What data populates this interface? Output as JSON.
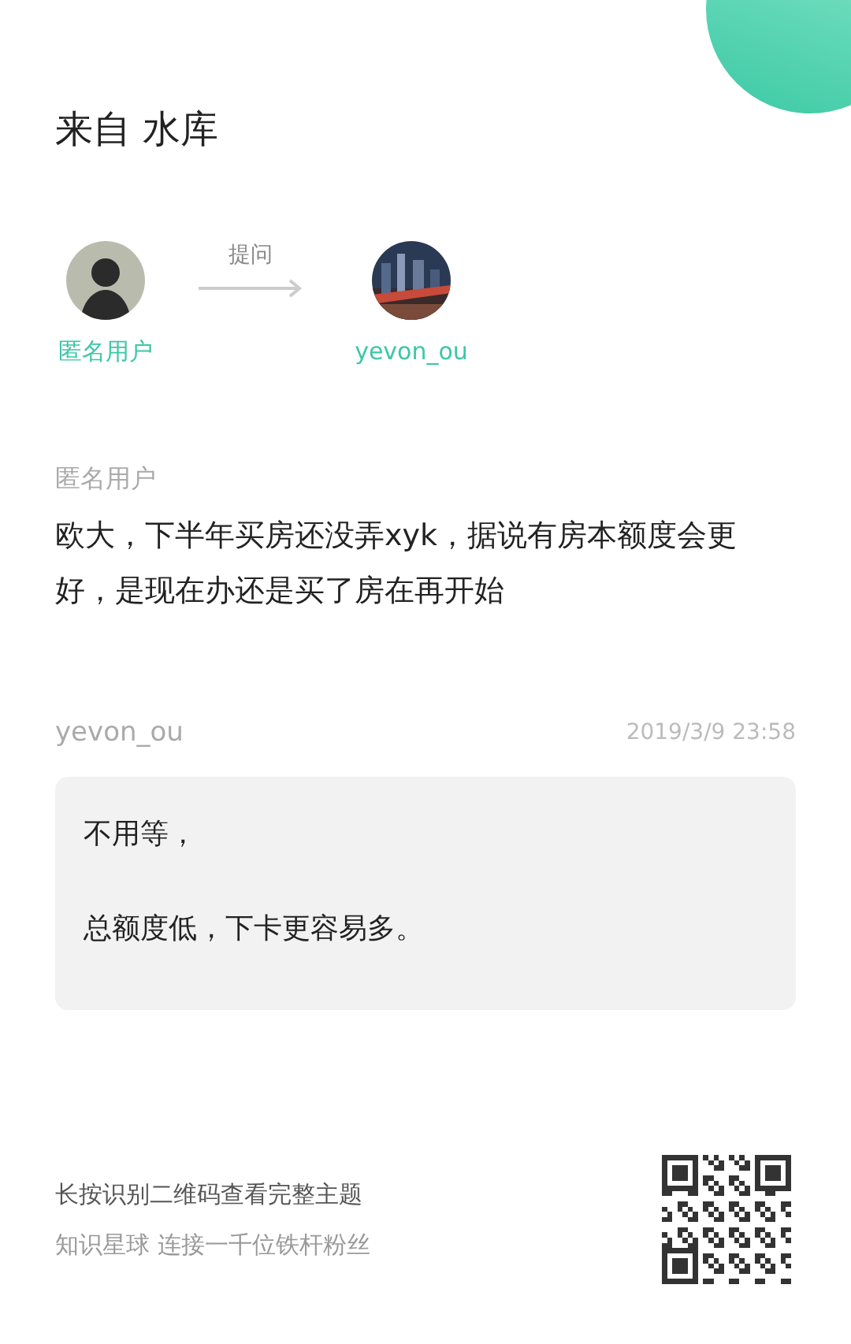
{
  "title": "来自 水库",
  "flow": {
    "asker": {
      "name": "匿名用户"
    },
    "action": "提问",
    "answerer": {
      "name": "yevon_ou"
    }
  },
  "question": {
    "author": "匿名用户",
    "text": "欧大，下半年买房还没弄xyk，据说有房本额度会更好，是现在办还是买了房在再开始"
  },
  "answer": {
    "author": "yevon_ou",
    "time": "2019/3/9 23:58",
    "paragraphs": [
      "不用等，",
      "总额度低，下卡更容易多。"
    ]
  },
  "footer": {
    "lines": [
      "长按识别二维码查看完整主题",
      "知识星球 连接一千位铁杆粉丝"
    ]
  }
}
